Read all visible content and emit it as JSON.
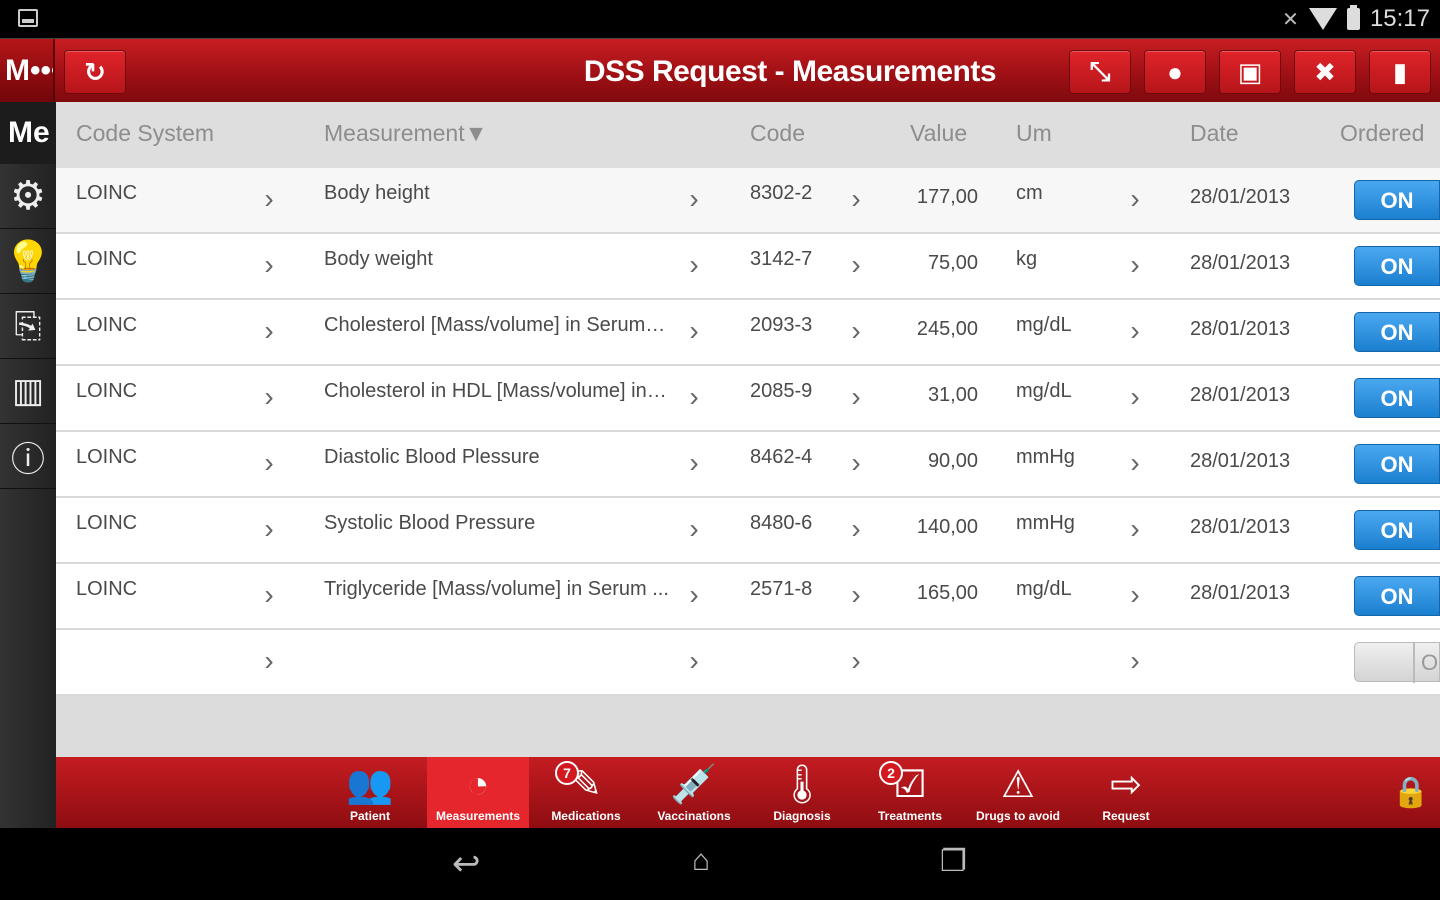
{
  "status_bar": {
    "time": "15:17"
  },
  "header": {
    "logo_text": "M•••",
    "title": "DSS Request - Measurements",
    "refresh_icon": "refresh-icon",
    "right_buttons": [
      "collapse-icon",
      "bulb-icon",
      "save-icon",
      "close-icon",
      "trash-icon"
    ]
  },
  "sidebar": {
    "title": "Me",
    "items": [
      "gear-icon",
      "bulb-icon",
      "export-icon",
      "chart-icon",
      "info-icon"
    ]
  },
  "table": {
    "headers": {
      "code_system": "Code System",
      "measurement": "Measurement",
      "code": "Code",
      "value": "Value",
      "um": "Um",
      "date": "Date",
      "ordered": "Ordered"
    },
    "rows": [
      {
        "code_system": "LOINC",
        "measurement": "Body height",
        "code": "8302-2",
        "value": "177,00",
        "um": "cm",
        "date": "28/01/2013",
        "ordered": "ON"
      },
      {
        "code_system": "LOINC",
        "measurement": "Body weight",
        "code": "3142-7",
        "value": "75,00",
        "um": "kg",
        "date": "28/01/2013",
        "ordered": "ON"
      },
      {
        "code_system": "LOINC",
        "measurement": "Cholesterol [Mass/volume] in Serum o...",
        "code": "2093-3",
        "value": "245,00",
        "um": "mg/dL",
        "date": "28/01/2013",
        "ordered": "ON"
      },
      {
        "code_system": "LOINC",
        "measurement": "Cholesterol in HDL [Mass/volume] in S...",
        "code": "2085-9",
        "value": "31,00",
        "um": "mg/dL",
        "date": "28/01/2013",
        "ordered": "ON"
      },
      {
        "code_system": "LOINC",
        "measurement": "Diastolic Blood Plessure",
        "code": "8462-4",
        "value": "90,00",
        "um": "mmHg",
        "date": "28/01/2013",
        "ordered": "ON"
      },
      {
        "code_system": "LOINC",
        "measurement": "Systolic Blood Pressure",
        "code": "8480-6",
        "value": "140,00",
        "um": "mmHg",
        "date": "28/01/2013",
        "ordered": "ON"
      },
      {
        "code_system": "LOINC",
        "measurement": "Triglyceride [Mass/volume] in Serum ...",
        "code": "2571-8",
        "value": "165,00",
        "um": "mg/dL",
        "date": "28/01/2013",
        "ordered": "ON"
      },
      {
        "code_system": "",
        "measurement": "",
        "code": "",
        "value": "",
        "um": "",
        "date": "",
        "ordered": "O"
      }
    ]
  },
  "tabs": [
    {
      "label": "Patient",
      "icon": "patient-icon",
      "badge": ""
    },
    {
      "label": "Measurements",
      "icon": "gauge-icon",
      "badge": "",
      "active": true
    },
    {
      "label": "Medications",
      "icon": "medications-icon",
      "badge": "7"
    },
    {
      "label": "Vaccinations",
      "icon": "syringe-icon",
      "badge": ""
    },
    {
      "label": "Diagnosis",
      "icon": "thermometer-icon",
      "badge": ""
    },
    {
      "label": "Treatments",
      "icon": "treatments-icon",
      "badge": "2"
    },
    {
      "label": "Drugs to avoid",
      "icon": "warning-icon",
      "badge": ""
    },
    {
      "label": "Request",
      "icon": "request-icon",
      "badge": ""
    }
  ]
}
